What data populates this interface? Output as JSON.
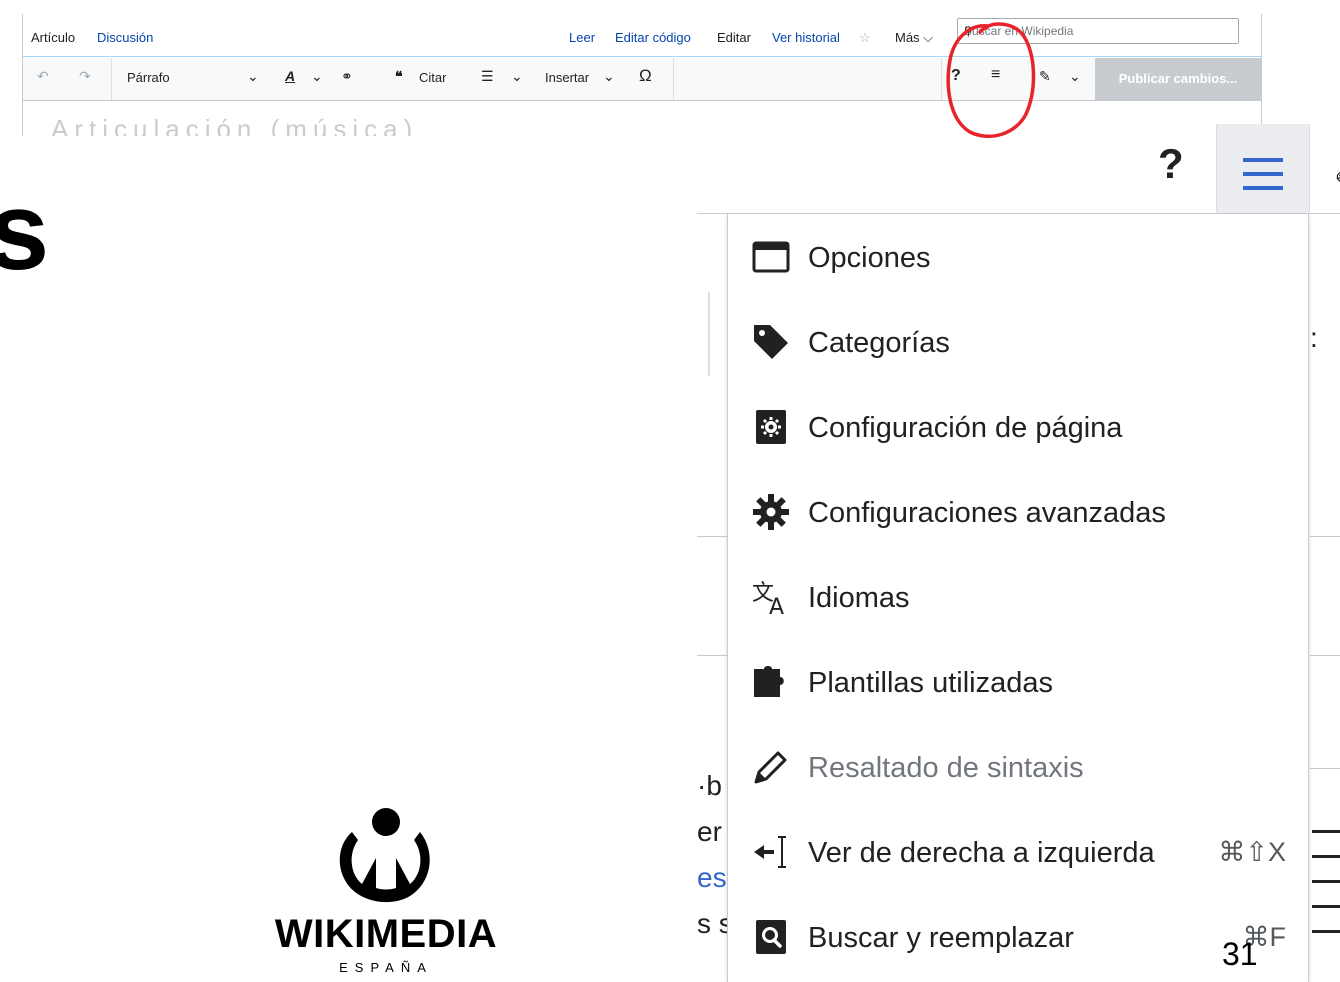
{
  "tabs": {
    "article": "Artículo",
    "discussion": "Discusión",
    "read": "Leer",
    "edit_source": "Editar código",
    "edit": "Editar",
    "history": "Ver historial",
    "more": "Más"
  },
  "search": {
    "placeholder": "Buscar en Wikipedia"
  },
  "toolbar": {
    "paragraph": "Párrafo",
    "cite": "Citar",
    "insert": "Insertar",
    "help": "?",
    "publish": "Publicar cambios..."
  },
  "ghost_title": "Articulación (música)",
  "big_toolbar": {
    "help": "?"
  },
  "menu": {
    "items": [
      {
        "label": "Opciones",
        "icon": "window-icon",
        "disabled": false,
        "shortcut": ""
      },
      {
        "label": "Categorías",
        "icon": "tag-icon",
        "disabled": false,
        "shortcut": ""
      },
      {
        "label": "Configuración de página",
        "icon": "settings-square-icon",
        "disabled": false,
        "shortcut": ""
      },
      {
        "label": "Configuraciones avanzadas",
        "icon": "gear-icon",
        "disabled": false,
        "shortcut": ""
      },
      {
        "label": "Idiomas",
        "icon": "language-icon",
        "disabled": false,
        "shortcut": ""
      },
      {
        "label": "Plantillas utilizadas",
        "icon": "puzzle-icon",
        "disabled": false,
        "shortcut": ""
      },
      {
        "label": "Resaltado de sintaxis",
        "icon": "pencil-icon",
        "disabled": true,
        "shortcut": ""
      },
      {
        "label": "Ver de derecha a izquierda",
        "icon": "rtl-icon",
        "disabled": false,
        "shortcut": "⌘⇧X"
      },
      {
        "label": "Buscar y reemplazar",
        "icon": "search-replace-icon",
        "disabled": false,
        "shortcut": "⌘F"
      }
    ]
  },
  "logo": {
    "word": "WIKIMEDIA",
    "sub": "ESPAÑA"
  },
  "slide_number": "31",
  "colors": {
    "link": "#0645ad",
    "accent": "#3366cc",
    "marker": "#e8232a"
  }
}
